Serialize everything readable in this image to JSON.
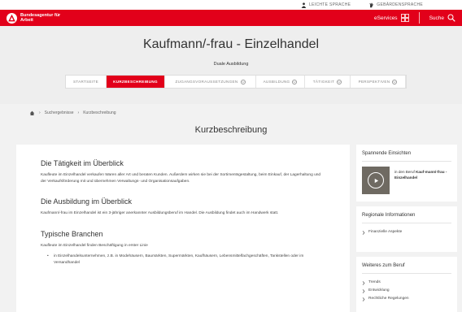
{
  "utility": {
    "easy_language": "LEICHTE SPRACHE",
    "sign_language": "GEBÄRDENSPRACHE"
  },
  "header": {
    "logo_text": "Bundesagentur für Arbeit",
    "eservices": "eServices",
    "search": "Suche"
  },
  "hero": {
    "title": "Kaufmann/-frau - Einzelhandel",
    "subtitle": "Duale Ausbildung"
  },
  "tabs": [
    {
      "label": "STARTSEITE",
      "active": false,
      "dropdown": false
    },
    {
      "label": "KURZBESCHREIBUNG",
      "active": true,
      "dropdown": false
    },
    {
      "label": "ZUGANGSVORAUSSETZUNGEN",
      "active": false,
      "dropdown": true
    },
    {
      "label": "AUSBILDUNG",
      "active": false,
      "dropdown": true
    },
    {
      "label": "TÄTIGKEIT",
      "active": false,
      "dropdown": true
    },
    {
      "label": "PERSPEKTIVEN",
      "active": false,
      "dropdown": true
    }
  ],
  "breadcrumb": {
    "items": [
      "Suchergebnisse",
      "Kurzbeschreibung"
    ]
  },
  "section_title": "Kurzbeschreibung",
  "main": {
    "sections": [
      {
        "heading": "Die Tätigkeit im Überblick",
        "text": "Kaufleute im Einzelhandel verkaufen Waren aller Art und beraten Kunden. Außerdem wirken sie bei der Sortimentsgestaltung, beim Einkauf, der Lagerhaltung und der Verkaufsförderung mit und übernehmen Verwaltungs- und Organisationsaufgaben."
      },
      {
        "heading": "Die Ausbildung im Überblick",
        "text": "Kaufmann/-frau im Einzelhandel ist ein 3-jähriger anerkannter Ausbildungsberuf im Handel. Die Ausbildung findet auch im Handwerk statt."
      },
      {
        "heading": "Typische Branchen",
        "text": "Kaufleute im Einzelhandel finden Beschäftigung in erster Linie",
        "list": [
          "in Einzelhandelsunternehmen, z.B. in Modehäusern, Baumärkten, Supermärkten, Kaufhäusern, Lebensmittelfachgeschäften, Tankstellen oder im Versandhandel"
        ]
      }
    ]
  },
  "sidebar": {
    "insights": {
      "title": "Spannende Einsichten",
      "text_prefix": "in den Beruf",
      "text_bold": "Kauf-mann/-frau - Einzelhandel"
    },
    "regional": {
      "title": "Regionale Informationen",
      "links": [
        "Finanzielle Aspekte"
      ]
    },
    "more": {
      "title": "Weiteres zum Beruf",
      "links": [
        "Trends",
        "Entwicklung",
        "Rechtliche Regelungen"
      ]
    }
  },
  "colors": {
    "brand_red": "#e2001a",
    "hero_bg": "#eeeeee",
    "page_bg": "#f2f2f2"
  }
}
